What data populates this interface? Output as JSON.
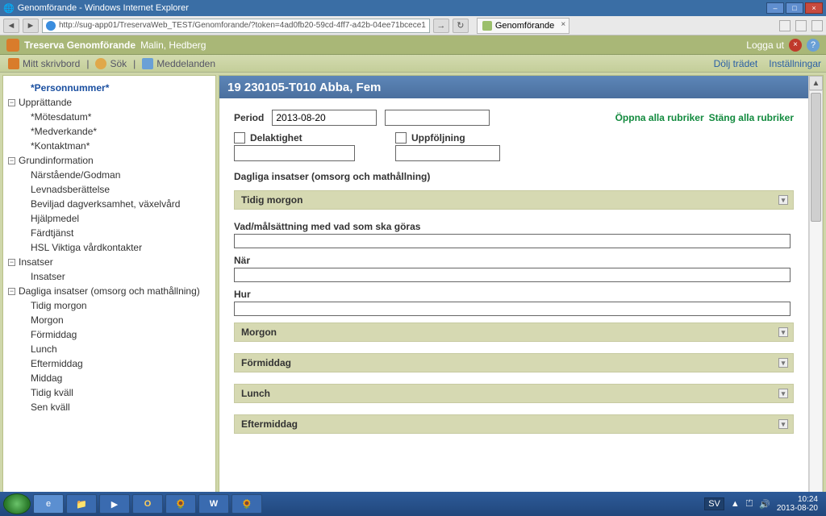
{
  "window": {
    "title": "Genomförande - Windows Internet Explorer"
  },
  "browser": {
    "url": "http://sug-app01/TreservaWeb_TEST/Genomforande/?token=4ad0fb20-59cd-4ff7-a42b-04ee71bcece1",
    "tab_label": "Genomförande"
  },
  "app_header": {
    "product": "Treserva Genomförande",
    "user": "Malin, Hedberg",
    "logout": "Logga ut"
  },
  "menu": {
    "desktop": "Mitt skrivbord",
    "search": "Sök",
    "messages": "Meddelanden",
    "hide_tree": "Dölj trädet",
    "settings": "Inställningar"
  },
  "tree": {
    "personnummer": "*Personnummer*",
    "upprattande": "Upprättande",
    "motesdatum": "*Mötesdatum*",
    "medverkande": "*Medverkande*",
    "kontaktman": "*Kontaktman*",
    "grundinfo": "Grundinformation",
    "narstaende": "Närstående/Godman",
    "levnads": "Levnadsberättelse",
    "beviljad": "Beviljad dagverksamhet, växelvård",
    "hjalpmedel": "Hjälpmedel",
    "fardtjanst": "Färdtjänst",
    "hsl": "HSL Viktiga vårdkontakter",
    "insatser_h": "Insatser",
    "insatser": "Insatser",
    "dagliga_h": "Dagliga insatser (omsorg och mathållning)",
    "tidig_morgon": "Tidig morgon",
    "morgon": "Morgon",
    "formiddag": "Förmiddag",
    "lunch": "Lunch",
    "eftermiddag": "Eftermiddag",
    "middag": "Middag",
    "tidig_kvall": "Tidig kväll",
    "sen_kvall": "Sen kväll"
  },
  "page": {
    "title": "19 230105-T010 Abba, Fem",
    "period_label": "Period",
    "period_from": "2013-08-20",
    "period_to": "",
    "open_all": "Öppna alla rubriker",
    "close_all": "Stäng alla rubriker",
    "delaktighet": "Delaktighet",
    "uppfoljning": "Uppföljning",
    "section_heading": "Dagliga insatser (omsorg och mathållning)",
    "bands": {
      "tidig_morgon": "Tidig morgon",
      "morgon": "Morgon",
      "formiddag": "Förmiddag",
      "lunch": "Lunch",
      "eftermiddag": "Eftermiddag"
    },
    "fields": {
      "vad": "Vad/målsättning med vad som ska göras",
      "nar": "När",
      "hur": "Hur"
    }
  },
  "taskbar": {
    "lang": "SV",
    "time": "10:24",
    "date": "2013-08-20"
  }
}
